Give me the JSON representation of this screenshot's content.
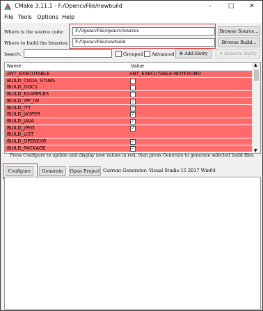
{
  "window": {
    "title": "CMake 3.11.1 - F:/OpencvFile/newbuild"
  },
  "menu": [
    "File",
    "Tools",
    "Options",
    "Help"
  ],
  "source": {
    "label": "Where is the source code:",
    "value": "F:/OpencvFile/opencv/sources",
    "browse": "Browse Source..."
  },
  "build": {
    "label": "Where to build the binaries:",
    "value": "F:/OpencvFile/newbuild",
    "browse": "Browse Build..."
  },
  "search": {
    "label": "Search:",
    "value": "",
    "grouped": "Grouped",
    "advanced": "Advanced",
    "add_entry": "Add Entry",
    "remove_entry": "Remove Entry"
  },
  "table": {
    "headers": [
      "Name",
      "Value"
    ],
    "rows": [
      {
        "name": "ANT_EXECUTABLE",
        "value": "ANT_EXECUTABLE-NOTFOUND",
        "type": "text"
      },
      {
        "name": "BUILD_CUDA_STUBS",
        "value": false,
        "type": "bool"
      },
      {
        "name": "BUILD_DOCS",
        "value": false,
        "type": "bool"
      },
      {
        "name": "BUILD_EXAMPLES",
        "value": false,
        "type": "bool"
      },
      {
        "name": "BUILD_IPP_IW",
        "value": true,
        "type": "bool"
      },
      {
        "name": "BUILD_ITT",
        "value": true,
        "type": "bool"
      },
      {
        "name": "BUILD_JASPER",
        "value": true,
        "type": "bool"
      },
      {
        "name": "BUILD_JAVA",
        "value": true,
        "type": "bool"
      },
      {
        "name": "BUILD_JPEG",
        "value": true,
        "type": "bool"
      },
      {
        "name": "BUILD_LIST",
        "value": "",
        "type": "text"
      },
      {
        "name": "BUILD_OPENEXR",
        "value": true,
        "type": "bool"
      },
      {
        "name": "BUILD_PACKAGE",
        "value": true,
        "type": "bool"
      }
    ],
    "row_color": "#ff6b6b"
  },
  "message": "Press Configure to update and display new values in red, then press Generate to generate selected build files.",
  "actions": {
    "configure": "Configure",
    "generate": "Generate",
    "open_project": "Open Project",
    "generator": "Current Generator: Visual Studio 15 2017 Win64"
  },
  "colors": {
    "highlight": "#d93a3a",
    "accent": "#1a5fb4"
  }
}
